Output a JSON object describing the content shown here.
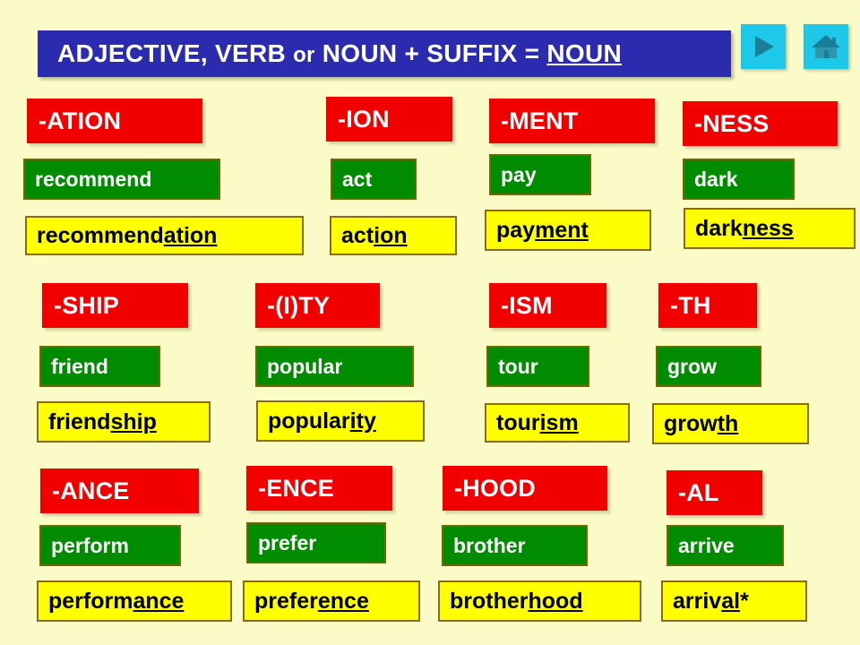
{
  "slide": {
    "background_color": "#fbfbc8",
    "title": {
      "full_text": "ADJECTIVE, VERB or NOUN + SUFFIX = NOUN",
      "part1": "ADJECTIVE, VERB ",
      "part_or": "or",
      "part2": " NOUN + SUFFIX = ",
      "part_underlined": "NOUN",
      "banner_color": "#2b2baf",
      "text_color": "#ffffff"
    }
  },
  "nav": {
    "next_label": "next-slide",
    "home_label": "home",
    "button_color": "#1ec8e8",
    "glyph_color": "#1a7f96"
  },
  "colors": {
    "suffix": "#f20000",
    "base": "#008c00",
    "derived": "#ffff00",
    "base_border": "#6b6b00",
    "derived_border": "#8a6a14"
  },
  "groups": [
    {
      "suffix": "-ATION",
      "base": "recommend",
      "derived_stem": "recommend",
      "derived_suffix": "ation",
      "derived_tail": ""
    },
    {
      "suffix": "-ION",
      "base": "act",
      "derived_stem": "act",
      "derived_suffix": "ion",
      "derived_tail": ""
    },
    {
      "suffix": "-MENT",
      "base": "pay",
      "derived_stem": "pay",
      "derived_suffix": "ment",
      "derived_tail": ""
    },
    {
      "suffix": "-NESS",
      "base": "dark",
      "derived_stem": "dark",
      "derived_suffix": "ness",
      "derived_tail": ""
    },
    {
      "suffix": "-SHIP",
      "base": "friend",
      "derived_stem": "friend",
      "derived_suffix": "ship",
      "derived_tail": ""
    },
    {
      "suffix": "-(I)TY",
      "base": "popular",
      "derived_stem": "popular",
      "derived_suffix": "ity",
      "derived_tail": ""
    },
    {
      "suffix": "-ISM",
      "base": "tour",
      "derived_stem": "tour",
      "derived_suffix": "ism",
      "derived_tail": ""
    },
    {
      "suffix": "-TH",
      "base": "grow",
      "derived_stem": "grow",
      "derived_suffix": "th",
      "derived_tail": ""
    },
    {
      "suffix": "-ANCE",
      "base": "perform",
      "derived_stem": "perform",
      "derived_suffix": "ance",
      "derived_tail": ""
    },
    {
      "suffix": "-ENCE",
      "base": "prefer",
      "derived_stem": "prefer",
      "derived_suffix": "ence",
      "derived_tail": ""
    },
    {
      "suffix": "-HOOD",
      "base": "brother",
      "derived_stem": "brother",
      "derived_suffix": "hood",
      "derived_tail": ""
    },
    {
      "suffix": "-AL",
      "base": "arrive",
      "derived_stem": "arriv",
      "derived_suffix": "al",
      "derived_tail": "*"
    }
  ]
}
